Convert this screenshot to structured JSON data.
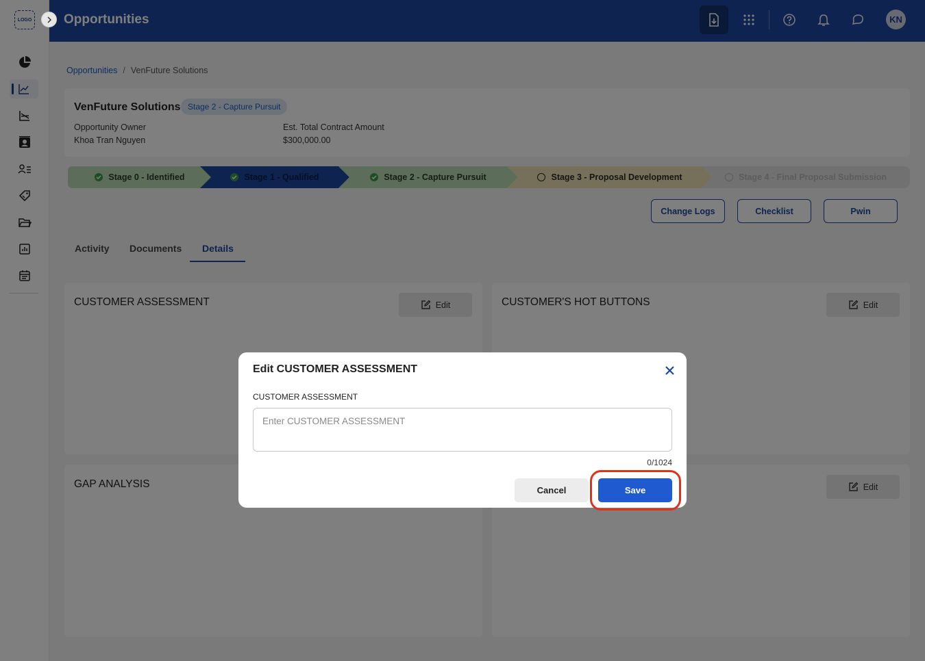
{
  "app": {
    "logo_text": "LOGO",
    "page_title": "Opportunities",
    "avatar_initials": "KN"
  },
  "sidebar": {
    "items": [
      {
        "icon": "pie-chart-icon"
      },
      {
        "icon": "trend-line-icon",
        "active": true
      },
      {
        "icon": "area-chart-icon"
      },
      {
        "icon": "contact-card-icon"
      },
      {
        "icon": "user-list-icon"
      },
      {
        "icon": "tag-icon"
      },
      {
        "icon": "folder-icon"
      },
      {
        "icon": "report-icon"
      },
      {
        "icon": "calendar-icon"
      }
    ]
  },
  "header_icons": [
    "download-doc-icon",
    "apps-grid-icon",
    "help-icon",
    "bell-icon",
    "chat-icon"
  ],
  "breadcrumb": {
    "root": "Opportunities",
    "separator": "/",
    "current": "VenFuture Solutions"
  },
  "opportunity": {
    "name": "VenFuture Solutions",
    "stage_badge": "Stage 2 - Capture Pursuit",
    "owner_label": "Opportunity Owner",
    "owner_value": "Khoa Tran Nguyen",
    "amount_label": "Est. Total Contract Amount",
    "amount_value": "$300,000.00"
  },
  "stages": [
    {
      "label": "Stage 0 - Identified",
      "status": "done"
    },
    {
      "label": "Stage 1 - Qualified",
      "status": "done"
    },
    {
      "label": "Stage 2 - Capture Pursuit",
      "status": "done"
    },
    {
      "label": "Stage 3 - Proposal Development",
      "status": "current"
    },
    {
      "label": "Stage 4 - Final Proposal Submission",
      "status": "pending"
    }
  ],
  "actions": {
    "change_logs": "Change Logs",
    "checklist": "Checklist",
    "pwin": "Pwin"
  },
  "tabs": [
    {
      "label": "Activity"
    },
    {
      "label": "Documents"
    },
    {
      "label": "Details",
      "active": true
    }
  ],
  "sections": {
    "customer_assessment": "CUSTOMER ASSESSMENT",
    "hot_buttons": "CUSTOMER'S HOT BUTTONS",
    "gap_analysis": "GAP ANALYSIS",
    "edit_label": "Edit"
  },
  "modal": {
    "title": "Edit CUSTOMER ASSESSMENT",
    "field_label": "CUSTOMER ASSESSMENT",
    "placeholder": "Enter CUSTOMER ASSESSMENT",
    "char_count": "0/1024",
    "cancel_label": "Cancel",
    "save_label": "Save"
  },
  "colors": {
    "header_blue": "#1c479f",
    "stage_done_green": "#b9dcb4",
    "stage_qualified_blue": "#1c479f",
    "stage_current_tan": "#ece0b4",
    "stage_pending_gray": "#e2e2e2",
    "save_blue": "#1f5ad1",
    "highlight_red": "#e0301e"
  }
}
